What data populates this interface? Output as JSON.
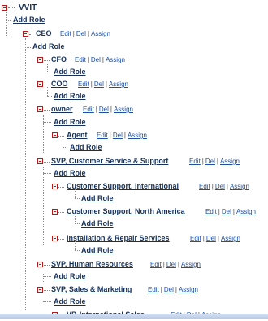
{
  "tree": {
    "root": {
      "label": "VVIT",
      "add_role": "Add Role"
    },
    "actions": {
      "edit": "Edit",
      "del": "Del",
      "assign": "Assign",
      "separator": "|"
    },
    "nodes": [
      {
        "id": "ceo",
        "label": "CEO",
        "add_role": "Add Role"
      },
      {
        "id": "cfo",
        "label": "CFO",
        "add_role": "Add Role"
      },
      {
        "id": "coo",
        "label": "COO",
        "add_role": "Add Role"
      },
      {
        "id": "owner",
        "label": "owner",
        "add_role": "Add Role"
      },
      {
        "id": "agent",
        "label": "Agent",
        "add_role": "Add Role"
      },
      {
        "id": "svp_cs",
        "label": "SVP, Customer Service & Support",
        "add_role": "Add Role"
      },
      {
        "id": "cs_intl",
        "label": "Customer Support, International",
        "add_role": "Add Role"
      },
      {
        "id": "cs_na",
        "label": "Customer Support, North America",
        "add_role": "Add Role"
      },
      {
        "id": "install",
        "label": "Installation & Repair Services",
        "add_role": "Add Role"
      },
      {
        "id": "svp_hr",
        "label": "SVP, Human Resources",
        "add_role": "Add Role"
      },
      {
        "id": "svp_sm",
        "label": "SVP, Sales & Marketing",
        "add_role": "Add Role"
      },
      {
        "id": "vp_intl",
        "label": "VP, International Sales"
      }
    ]
  }
}
